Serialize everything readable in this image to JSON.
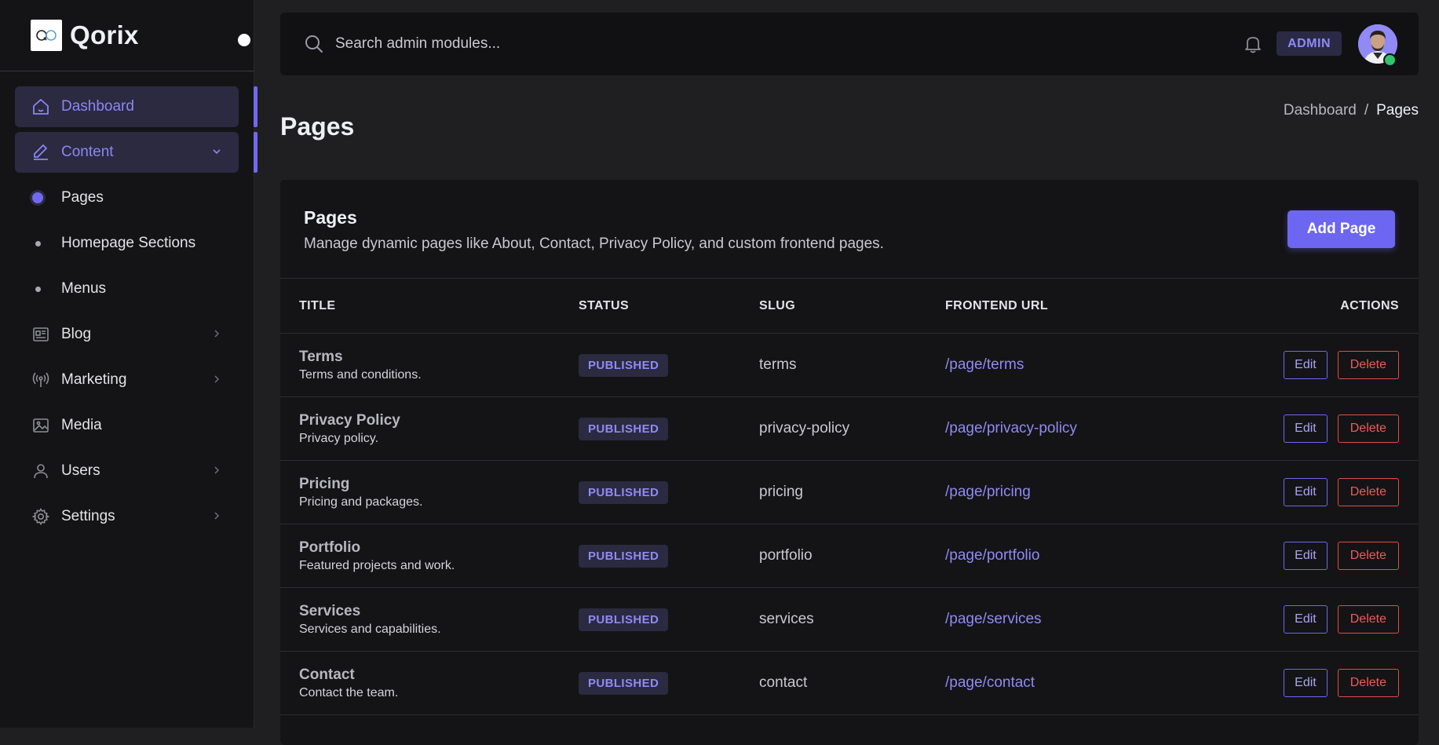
{
  "brand": {
    "name": "Qorix",
    "logo_text": "QO"
  },
  "sidebar": {
    "items": [
      {
        "label": "Dashboard",
        "icon": "home-icon",
        "active": true
      },
      {
        "label": "Content",
        "icon": "pencil-icon",
        "active": true,
        "expanded": true
      },
      {
        "label": "Blog",
        "icon": "newspaper-icon"
      },
      {
        "label": "Marketing",
        "icon": "broadcast-icon"
      },
      {
        "label": "Media",
        "icon": "image-icon"
      },
      {
        "label": "Users",
        "icon": "user-icon"
      },
      {
        "label": "Settings",
        "icon": "gear-icon"
      }
    ],
    "sub_items": [
      {
        "label": "Pages",
        "current": true
      },
      {
        "label": "Homepage Sections"
      },
      {
        "label": "Menus"
      }
    ]
  },
  "topbar": {
    "search_placeholder": "Search admin modules...",
    "role_badge": "ADMIN"
  },
  "page": {
    "title": "Pages",
    "breadcrumb": {
      "parent": "Dashboard",
      "separator": "/",
      "current": "Pages"
    }
  },
  "card": {
    "title": "Pages",
    "subtitle": "Manage dynamic pages like About, Contact, Privacy Policy, and custom frontend pages.",
    "add_label": "Add Page"
  },
  "table": {
    "headers": [
      "TITLE",
      "STATUS",
      "SLUG",
      "FRONTEND URL",
      "ACTIONS"
    ],
    "rows": [
      {
        "title": "Terms",
        "desc": "Terms and conditions.",
        "status": "PUBLISHED",
        "slug": "terms",
        "url": "/page/terms",
        "edit": "Edit",
        "delete": "Delete"
      },
      {
        "title": "Privacy Policy",
        "desc": "Privacy policy.",
        "status": "PUBLISHED",
        "slug": "privacy-policy",
        "url": "/page/privacy-policy",
        "edit": "Edit",
        "delete": "Delete"
      },
      {
        "title": "Pricing",
        "desc": "Pricing and packages.",
        "status": "PUBLISHED",
        "slug": "pricing",
        "url": "/page/pricing",
        "edit": "Edit",
        "delete": "Delete"
      },
      {
        "title": "Portfolio",
        "desc": "Featured projects and work.",
        "status": "PUBLISHED",
        "slug": "portfolio",
        "url": "/page/portfolio",
        "edit": "Edit",
        "delete": "Delete"
      },
      {
        "title": "Services",
        "desc": "Services and capabilities.",
        "status": "PUBLISHED",
        "slug": "services",
        "url": "/page/services",
        "edit": "Edit",
        "delete": "Delete"
      },
      {
        "title": "Contact",
        "desc": "Contact the team.",
        "status": "PUBLISHED",
        "slug": "contact",
        "url": "/page/contact",
        "edit": "Edit",
        "delete": "Delete"
      }
    ]
  },
  "colors": {
    "accent": "#6d66f2",
    "accent_text": "#8f8af5",
    "danger": "#e24a4a",
    "background": "#1f1f21",
    "sidebar": "#141416",
    "online_status": "#31c46c"
  }
}
